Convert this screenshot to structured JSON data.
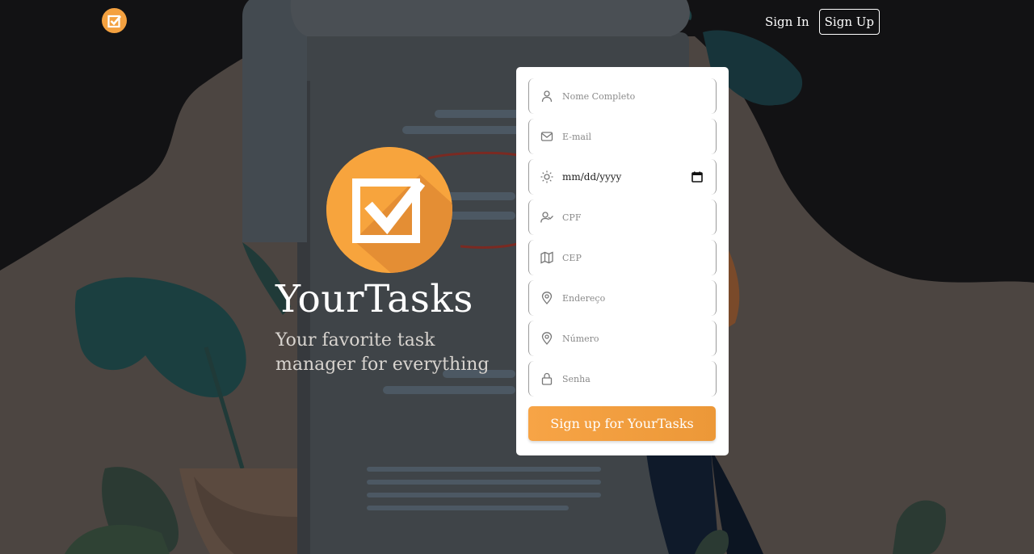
{
  "brand": {
    "name": "YourTasks",
    "tagline": "Your favorite task manager for everything",
    "accent": "#f4a140"
  },
  "nav": {
    "sign_in": "Sign In",
    "sign_up": "Sign Up"
  },
  "form": {
    "fields": [
      {
        "icon": "user-icon",
        "placeholder": "Nome Completo"
      },
      {
        "icon": "mail-icon",
        "placeholder": "E-mail"
      },
      {
        "icon": "sun-icon",
        "value": "mm/dd/yyyy"
      },
      {
        "icon": "user-check-icon",
        "placeholder": "CPF"
      },
      {
        "icon": "map-icon",
        "placeholder": "CEP"
      },
      {
        "icon": "map-pin-icon",
        "placeholder": "Endereço"
      },
      {
        "icon": "map-pin-icon",
        "placeholder": "Número"
      },
      {
        "icon": "lock-icon",
        "placeholder": "Senha"
      }
    ],
    "submit_label": "Sign up for YourTasks"
  }
}
